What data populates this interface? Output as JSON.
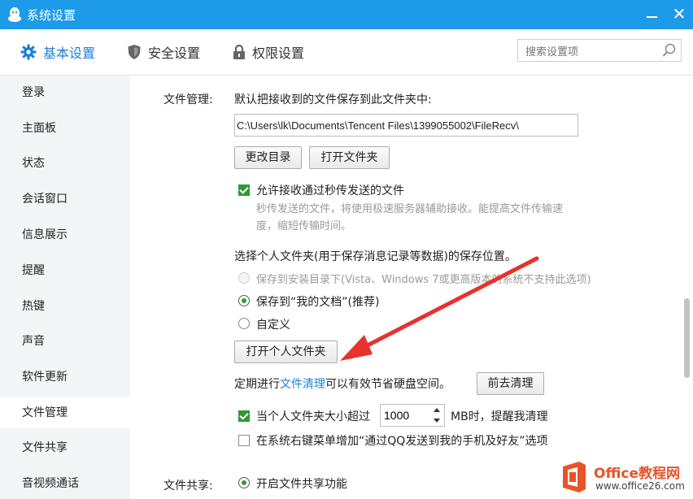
{
  "window": {
    "title": "系统设置"
  },
  "tabs": [
    {
      "label": "基本设置",
      "icon": "gear-icon",
      "active": true
    },
    {
      "label": "安全设置",
      "icon": "shield-icon"
    },
    {
      "label": "权限设置",
      "icon": "lock-icon"
    }
  ],
  "search": {
    "placeholder": "搜索设置项"
  },
  "sidebar": {
    "items": [
      {
        "label": "登录"
      },
      {
        "label": "主面板"
      },
      {
        "label": "状态"
      },
      {
        "label": "会话窗口"
      },
      {
        "label": "信息展示"
      },
      {
        "label": "提醒"
      },
      {
        "label": "热键"
      },
      {
        "label": "声音"
      },
      {
        "label": "软件更新"
      },
      {
        "label": "文件管理",
        "active": true
      },
      {
        "label": "文件共享"
      },
      {
        "label": "音视频通话"
      }
    ]
  },
  "file_mgmt": {
    "section_label": "文件管理:",
    "save_desc": "默认把接收到的文件保存到此文件夹中:",
    "path": "C:\\Users\\lk\\Documents\\Tencent Files\\1399055002\\FileRecv\\",
    "change_dir_button": "更改目录",
    "open_folder_button": "打开文件夹",
    "allow_instant": {
      "label": "允许接收通过秒传发送的文件",
      "checked": true
    },
    "instant_hint_1": "秒传发送的文件，将使用极速服务器辅助接收。能提高文件传输速",
    "instant_hint_2": "度，缩短传输时间。",
    "personal_folder_desc": "选择个人文件夹(用于保存消息记录等数据)的保存位置。",
    "radio_install": "保存到安装目录下(Vista、Windows 7或更高版本的系统不支持此选项)",
    "radio_mydocs": "保存到“我的文档”(推荐)",
    "radio_custom": "自定义",
    "open_personal_button": "打开个人文件夹",
    "cleanup_prefix": "定期进行",
    "cleanup_link": "文件清理",
    "cleanup_suffix": "可以有效节省硬盘空间。",
    "cleanup_button": "前去清理",
    "size_check": {
      "label": "当个人文件夹大小超过",
      "checked": true
    },
    "size_value": "1000",
    "size_unit": "MB时，提醒我清理",
    "context_menu": {
      "label": "在系统右键菜单增加“通过QQ发送到我的手机及好友”选项",
      "checked": false
    }
  },
  "file_share": {
    "section_label": "文件共享:",
    "enable_label": "开启文件共享功能"
  },
  "watermark": {
    "text": "Office教程网",
    "url": "www.office26.com"
  },
  "colors": {
    "titlebar": "#1e9be8",
    "accent": "#1d7fd8",
    "check": "#2f9a36",
    "arrow": "#e8322d"
  }
}
